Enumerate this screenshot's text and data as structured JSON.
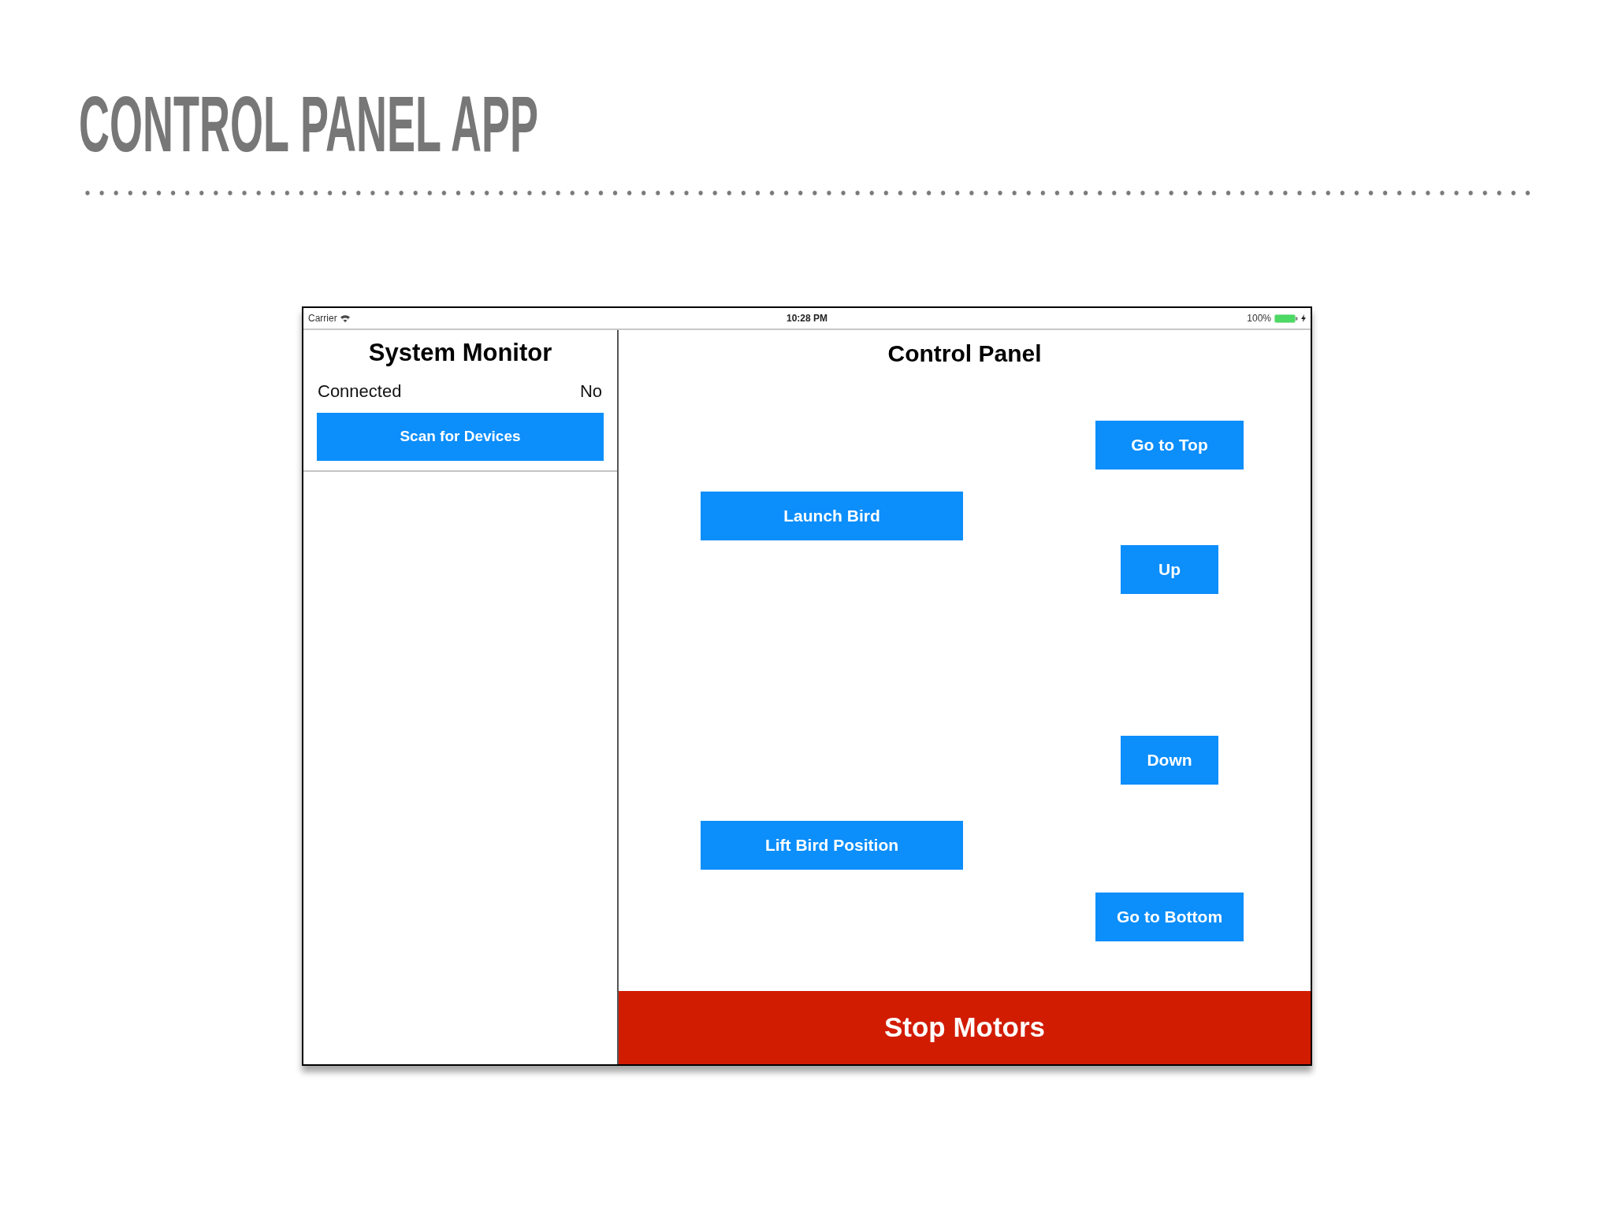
{
  "slide": {
    "title": "CONTROL PANEL APP"
  },
  "status_bar": {
    "carrier": "Carrier",
    "time": "10:28 PM",
    "battery": "100%"
  },
  "system_monitor": {
    "title": "System Monitor",
    "rows": [
      {
        "label": "Connected",
        "value": "No"
      }
    ],
    "button": "Scan for Devices"
  },
  "control_panel": {
    "title": "Control Panel",
    "left_buttons": [
      "Launch Bird",
      "Lift Bird Position"
    ],
    "right_buttons": [
      "Go to Top",
      "Up",
      "Down",
      "Go to Bottom"
    ],
    "stop_button": "Stop Motors"
  }
}
